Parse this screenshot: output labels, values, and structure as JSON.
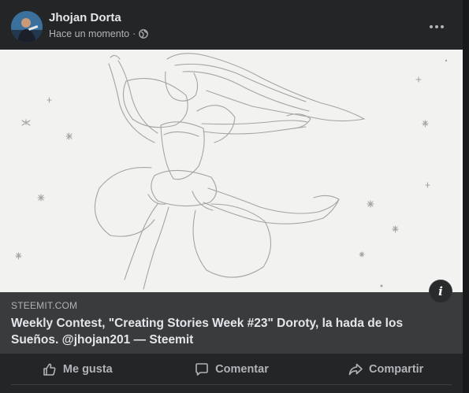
{
  "post": {
    "author": "Jhojan Dorta",
    "time": "Hace un momento",
    "separator": "·",
    "privacy_icon": "globe-icon",
    "more_icon": "more-dots-icon"
  },
  "link_preview": {
    "domain": "STEEMIT.COM",
    "title": "Weekly Contest, \"Creating Stories Week #23\" Doroty, la hada de los Sueños. @jhojan201 — Steemit",
    "info_icon": "info-icon",
    "info_glyph": "i"
  },
  "actions": {
    "like": "Me gusta",
    "comment": "Comentar",
    "share": "Compartir"
  },
  "colors": {
    "card_bg": "#242526",
    "link_bg": "#3a3b3c",
    "text_primary": "#e4e6eb",
    "text_secondary": "#b0b3b8"
  }
}
